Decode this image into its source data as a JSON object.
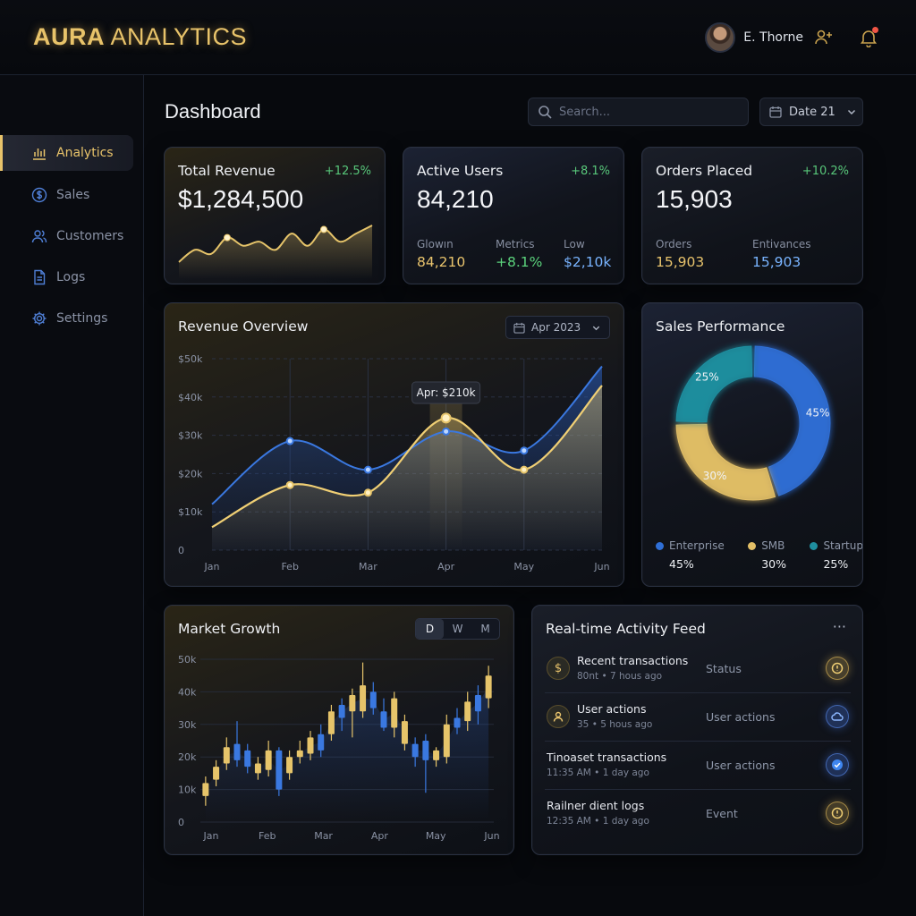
{
  "app": {
    "brand_bold": "AURA",
    "brand_light": " ANALYTICS"
  },
  "user": {
    "name": "E. Thorne"
  },
  "sidebar": {
    "items": [
      {
        "label": "Analytics",
        "icon": "bar-chart-icon",
        "active": true
      },
      {
        "label": "Sales",
        "icon": "dollar-icon",
        "active": false
      },
      {
        "label": "Customers",
        "icon": "users-icon",
        "active": false
      },
      {
        "label": "Logs",
        "icon": "document-icon",
        "active": false
      },
      {
        "label": "Settings",
        "icon": "gear-icon",
        "active": false
      }
    ]
  },
  "header": {
    "title": "Dashboard",
    "search_placeholder": "Search...",
    "date_label": "Date 21"
  },
  "kpis": {
    "revenue": {
      "title": "Total Revenue",
      "delta": "+12.5%",
      "value": "$1,284,500"
    },
    "users": {
      "title": "Active Users",
      "delta": "+8.1%",
      "value": "84,210",
      "subs": [
        {
          "label": "Glowın",
          "value": "84,210"
        },
        {
          "label": "Metrics",
          "value": "+8.1%"
        },
        {
          "label": "Low",
          "value": "$2,10k"
        }
      ]
    },
    "orders": {
      "title": "Orders Placed",
      "delta": "+10.2%",
      "value": "15,903",
      "subs": [
        {
          "label": "Orders",
          "value": "15,903"
        },
        {
          "label": "Entivances",
          "value": "15,903"
        }
      ]
    }
  },
  "revenue_overview": {
    "title": "Revenue Overview",
    "range_label": "Apr 2023",
    "tooltip": "Apr: $210k"
  },
  "sales_performance": {
    "title": "Sales Performance",
    "segments": [
      {
        "name": "Enterprise",
        "pct": "45%",
        "color": "#2f6fd6"
      },
      {
        "name": "SMB",
        "pct": "30%",
        "color": "#e3bf66"
      },
      {
        "name": "Startup",
        "pct": "25%",
        "color": "#1f8fa0"
      }
    ]
  },
  "market_growth": {
    "title": "Market Growth",
    "ranges": [
      "D",
      "W",
      "M"
    ],
    "selected_range": "D"
  },
  "activity_feed": {
    "title": "Real-time Activity Feed",
    "more": "···",
    "items": [
      {
        "title": "Recent transactions",
        "sub": "80nt • 7 hous ago",
        "kind": "Status",
        "icon": "dollar-icon",
        "badge": "info-icon",
        "tone": "gold"
      },
      {
        "title": "User actions",
        "sub": "35 • 5 hous ago",
        "kind": "User actions",
        "icon": "user-icon",
        "badge": "cloud-icon",
        "tone": "blue"
      },
      {
        "title": "Tinoaset transactions",
        "sub": "11:35 AM • 1 day ago",
        "kind": "User actions",
        "icon": "",
        "badge": "check-icon",
        "tone": "blue"
      },
      {
        "title": "Railner dient logs",
        "sub": "12:35 AM • 1 day ago",
        "kind": "Event",
        "icon": "",
        "badge": "info-icon",
        "tone": "gold"
      }
    ]
  },
  "chart_data": [
    {
      "type": "line",
      "title": "Revenue Overview",
      "x": [
        "Jan",
        "Feb",
        "Mar",
        "Apr",
        "May",
        "Jun"
      ],
      "ylim": [
        0,
        50
      ],
      "ytick_labels": [
        "0",
        "$10k",
        "$20k",
        "$30k",
        "$40k",
        "$50k"
      ],
      "grid": true,
      "series": [
        {
          "values": [
            12,
            28.5,
            21,
            31,
            26,
            48
          ],
          "color": "#3a78e0"
        },
        {
          "values": [
            6,
            17,
            15,
            34.5,
            21,
            43
          ],
          "color": "#e6c46a"
        }
      ]
    },
    {
      "type": "pie",
      "title": "Sales Performance",
      "categories": [
        "Enterprise",
        "SMB",
        "Startup"
      ],
      "values": [
        45,
        30,
        25
      ]
    },
    {
      "type": "bar",
      "title": "Market Growth",
      "x_tick_labels": [
        "Jan",
        "Feb",
        "Mar",
        "Apr",
        "May",
        "Jun"
      ],
      "ytick_labels": [
        "0",
        "10k",
        "20k",
        "30k",
        "40k",
        "50k"
      ],
      "ylim": [
        0,
        50
      ],
      "candles": [
        {
          "o": 8,
          "c": 12,
          "h": 14,
          "l": 5,
          "up": true
        },
        {
          "o": 13,
          "c": 17,
          "h": 19,
          "l": 11,
          "up": true
        },
        {
          "o": 18,
          "c": 23,
          "h": 26,
          "l": 16,
          "up": true
        },
        {
          "o": 24,
          "c": 19,
          "h": 31,
          "l": 17,
          "up": false
        },
        {
          "o": 22,
          "c": 17,
          "h": 24,
          "l": 15,
          "up": false
        },
        {
          "o": 15,
          "c": 18,
          "h": 20,
          "l": 13,
          "up": true
        },
        {
          "o": 16,
          "c": 22,
          "h": 25,
          "l": 14,
          "up": true
        },
        {
          "o": 22,
          "c": 10,
          "h": 23,
          "l": 8,
          "up": false
        },
        {
          "o": 15,
          "c": 20,
          "h": 22,
          "l": 13,
          "up": true
        },
        {
          "o": 20,
          "c": 22,
          "h": 25,
          "l": 18,
          "up": true
        },
        {
          "o": 21,
          "c": 26,
          "h": 28,
          "l": 19,
          "up": true
        },
        {
          "o": 27,
          "c": 22,
          "h": 30,
          "l": 20,
          "up": false
        },
        {
          "o": 27,
          "c": 34,
          "h": 36,
          "l": 25,
          "up": true
        },
        {
          "o": 36,
          "c": 32,
          "h": 38,
          "l": 28,
          "up": false
        },
        {
          "o": 34,
          "c": 39,
          "h": 41,
          "l": 26,
          "up": true
        },
        {
          "o": 42,
          "c": 34,
          "h": 49,
          "l": 32,
          "up": true
        },
        {
          "o": 40,
          "c": 35,
          "h": 43,
          "l": 33,
          "up": false
        },
        {
          "o": 29,
          "c": 34,
          "h": 38,
          "l": 28,
          "up": false
        },
        {
          "o": 29,
          "c": 38,
          "h": 40,
          "l": 26,
          "up": true
        },
        {
          "o": 31,
          "c": 24,
          "h": 33,
          "l": 22,
          "up": true
        },
        {
          "o": 24,
          "c": 20,
          "h": 26,
          "l": 17,
          "up": false
        },
        {
          "o": 25,
          "c": 19,
          "h": 27,
          "l": 9,
          "up": false
        },
        {
          "o": 19,
          "c": 22,
          "h": 23,
          "l": 17,
          "up": true
        },
        {
          "o": 20,
          "c": 30,
          "h": 33,
          "l": 18,
          "up": true
        },
        {
          "o": 29,
          "c": 32,
          "h": 35,
          "l": 27,
          "up": false
        },
        {
          "o": 31,
          "c": 37,
          "h": 40,
          "l": 28,
          "up": true
        },
        {
          "o": 34,
          "c": 39,
          "h": 42,
          "l": 30,
          "up": false
        },
        {
          "o": 38,
          "c": 45,
          "h": 48,
          "l": 35,
          "up": true
        }
      ]
    },
    {
      "type": "area",
      "title": "Total Revenue sparkline",
      "values": [
        2,
        5,
        4,
        8,
        6,
        7,
        5,
        9,
        6,
        10,
        7,
        9,
        11
      ]
    }
  ]
}
